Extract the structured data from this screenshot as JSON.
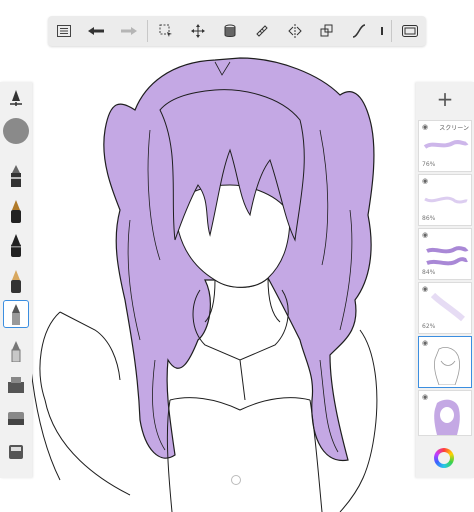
{
  "toolbar": {
    "icons": [
      "list-icon",
      "undo-icon",
      "redo-icon",
      "selection-icon",
      "transform-icon",
      "fill-icon",
      "ruler-icon",
      "symmetry-icon",
      "layer-transform-icon",
      "curve-icon",
      "more-icon",
      "fullscreen-icon"
    ]
  },
  "layers": [
    {
      "opacity": "76%",
      "name": "スクリーン"
    },
    {
      "opacity": "86%",
      "name": ""
    },
    {
      "opacity": "84%",
      "name": ""
    },
    {
      "opacity": "62%",
      "name": ""
    },
    {
      "opacity": "",
      "name": ""
    },
    {
      "opacity": "",
      "name": ""
    }
  ],
  "colors": {
    "hair": "#c4a8e4",
    "line": "#1e1e1e",
    "accent": "#3b8ee0",
    "panel": "#f1f1f1"
  },
  "right_panel": {
    "add_label": "+"
  }
}
